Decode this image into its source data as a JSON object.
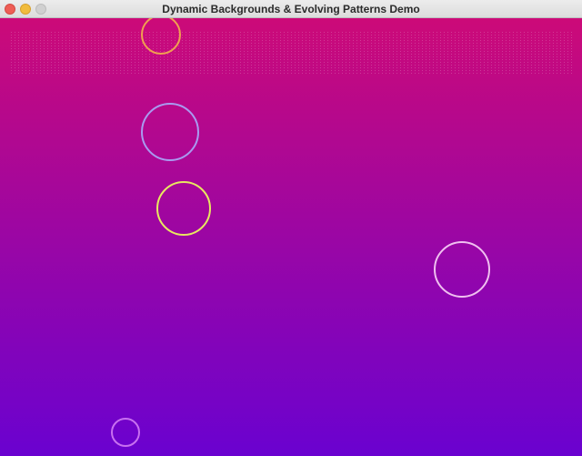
{
  "window": {
    "title": "Dynamic Backgrounds & Evolving Patterns Demo"
  },
  "background": {
    "type": "vertical-gradient",
    "top_color": "#cc0a78",
    "bottom_color": "#6a02d0"
  },
  "shapes": {
    "type": "ring",
    "rings": [
      {
        "name": "ring-orange",
        "color": "#f0a050"
      },
      {
        "name": "ring-lavender",
        "color": "#a99af0"
      },
      {
        "name": "ring-yellow",
        "color": "#e8e860"
      },
      {
        "name": "ring-pale-pink",
        "color": "#f0c0f0"
      },
      {
        "name": "ring-violet",
        "color": "#c870f0"
      }
    ]
  }
}
